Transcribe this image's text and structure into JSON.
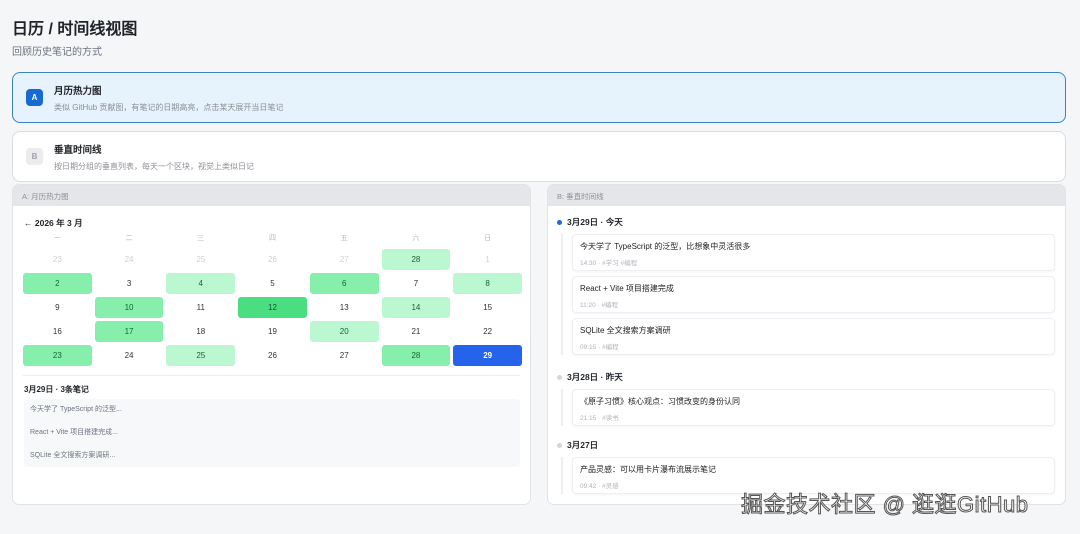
{
  "header": {
    "title": "日历 / 时间线视图",
    "subtitle": "回顾历史笔记的方式"
  },
  "options": [
    {
      "badge": "A",
      "title": "月历热力图",
      "desc": "类似 GitHub 贡献图，有笔记的日期高亮，点击某天展开当日笔记",
      "selected": true
    },
    {
      "badge": "B",
      "title": "垂直时间线",
      "desc": "按日期分组的垂直列表，每天一个区块，视觉上类似日记",
      "selected": false
    }
  ],
  "calendar": {
    "panel_title": "A: 月历热力图",
    "month_label": "← 2026 年 3 月",
    "weekdays": [
      "一",
      "二",
      "三",
      "四",
      "五",
      "六",
      "日"
    ],
    "days": [
      {
        "d": "23",
        "muted": true,
        "level": 0
      },
      {
        "d": "24",
        "muted": true,
        "level": 0
      },
      {
        "d": "25",
        "muted": true,
        "level": 0
      },
      {
        "d": "26",
        "muted": true,
        "level": 0
      },
      {
        "d": "27",
        "muted": true,
        "level": 0
      },
      {
        "d": "28",
        "muted": false,
        "level": 1
      },
      {
        "d": "1",
        "muted": true,
        "level": 0
      },
      {
        "d": "2",
        "level": 2
      },
      {
        "d": "3",
        "level": 0
      },
      {
        "d": "4",
        "level": 1
      },
      {
        "d": "5",
        "level": 0
      },
      {
        "d": "6",
        "level": 2
      },
      {
        "d": "7",
        "level": 0
      },
      {
        "d": "8",
        "level": 1
      },
      {
        "d": "9",
        "level": 0
      },
      {
        "d": "10",
        "level": 2
      },
      {
        "d": "11",
        "level": 0
      },
      {
        "d": "12",
        "level": 3
      },
      {
        "d": "13",
        "level": 0
      },
      {
        "d": "14",
        "level": 1
      },
      {
        "d": "15",
        "level": 0
      },
      {
        "d": "16",
        "level": 0
      },
      {
        "d": "17",
        "level": 2
      },
      {
        "d": "18",
        "level": 0
      },
      {
        "d": "19",
        "level": 0
      },
      {
        "d": "20",
        "level": 1
      },
      {
        "d": "21",
        "level": 0
      },
      {
        "d": "22",
        "level": 0
      },
      {
        "d": "23",
        "level": 2
      },
      {
        "d": "24",
        "level": 0
      },
      {
        "d": "25",
        "level": 1
      },
      {
        "d": "26",
        "level": 0
      },
      {
        "d": "27",
        "level": 0
      },
      {
        "d": "28",
        "level": 2
      },
      {
        "d": "29",
        "level": 0,
        "selected": true
      }
    ],
    "notes_header": "3月29日 · 3条笔记",
    "notes": [
      "今天学了 TypeScript 的泛型...",
      "React + Vite 项目搭建完成...",
      "SQLite 全文搜索方案调研..."
    ]
  },
  "timeline": {
    "panel_title": "B: 垂直时间线",
    "groups": [
      {
        "date": "3月29日 · 今天",
        "today": true,
        "items": [
          {
            "title": "今天学了 TypeScript 的泛型，比想象中灵活很多",
            "meta": "14:30 · #学习 #编程"
          },
          {
            "title": "React + Vite 项目搭建完成",
            "meta": "11:20 · #编程"
          },
          {
            "title": "SQLite 全文搜索方案调研",
            "meta": "09:15 · #编程"
          }
        ]
      },
      {
        "date": "3月28日 · 昨天",
        "today": false,
        "items": [
          {
            "title": "《原子习惯》核心观点：习惯改变的身份认同",
            "meta": "21:15 · #读书"
          }
        ]
      },
      {
        "date": "3月27日",
        "today": false,
        "items": [
          {
            "title": "产品灵感：可以用卡片瀑布流展示笔记",
            "meta": "09:42 · #灵感"
          }
        ]
      }
    ]
  },
  "watermark": "掘金技术社区 @ 逛逛GitHub"
}
